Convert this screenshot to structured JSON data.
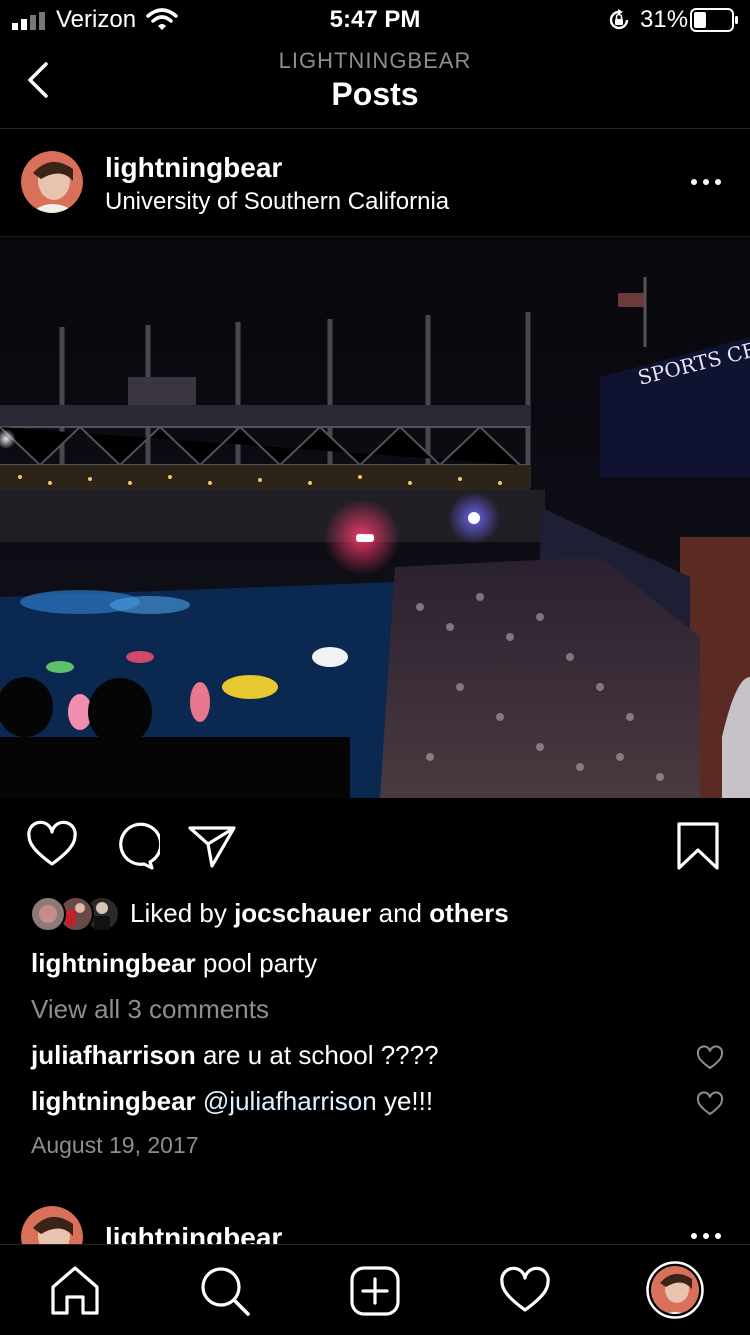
{
  "status_bar": {
    "carrier": "Verizon",
    "time": "5:47 PM",
    "battery": "31%"
  },
  "header": {
    "subtitle": "LIGHTNINGBEAR",
    "title": "Posts"
  },
  "post": {
    "username": "lightningbear",
    "location": "University of Southern California",
    "likes": {
      "prefix": "Liked by",
      "user": "jocschauer",
      "middle": "and",
      "others": "others"
    },
    "caption": {
      "username": "lightningbear",
      "text": "pool party"
    },
    "view_all_comments": "View all 3 comments",
    "comments": [
      {
        "username": "juliafharrison",
        "mention": "",
        "text": "are u at school ????"
      },
      {
        "username": "lightningbear",
        "mention": "@juliafharrison",
        "text": "ye!!!"
      }
    ],
    "date": "August 19, 2017",
    "photo_signage": "SPORTS CENTER"
  },
  "next_post": {
    "username": "lightningbear"
  },
  "icons": {
    "back": "back-chevron-icon",
    "more": "more-dots-icon",
    "like": "heart-icon",
    "comment": "comment-icon",
    "share": "send-icon",
    "save": "bookmark-icon",
    "home": "home-icon",
    "search": "search-icon",
    "new_post": "add-post-icon",
    "activity": "heart-icon",
    "profile": "profile-avatar"
  },
  "colors": {
    "background": "#000000",
    "text": "#ffffff",
    "muted": "#8e8e8e",
    "divider": "#262626"
  }
}
